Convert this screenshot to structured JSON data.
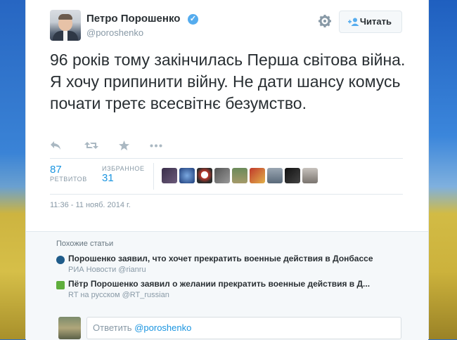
{
  "user": {
    "name": "Петро Порошенко",
    "handle": "@poroshenko"
  },
  "follow_button": {
    "label": "Читать"
  },
  "tweet": {
    "text": "96 років тому закінчилась Перша світова війна. Я хочу припинити війну. Не дати шансу комусь почати третє всесвітнє безумство."
  },
  "stats": {
    "retweets": {
      "count": "87",
      "label": "РЕТВИТОВ"
    },
    "favorites": {
      "count": "31",
      "label": "ИЗБРАННОЕ"
    }
  },
  "timestamp": "11:36 - 11 нояб. 2014 г.",
  "similar": {
    "title": "Похожие статьи",
    "articles": [
      {
        "title": "Порошенко заявил, что хочет прекратить военные действия в Донбассе",
        "source": "РИА Новости",
        "source_handle": "@rianru"
      },
      {
        "title": "Пётр Порошенко заявил о желании прекратить военные действия в Д...",
        "source": "RT на русском",
        "source_handle": "@RT_russian"
      }
    ]
  },
  "reply": {
    "prefix": "Ответить",
    "handle": "@poroshenko"
  },
  "colors": {
    "link": "#1b95e0",
    "verified": "#55acee",
    "muted": "#8899a6"
  }
}
